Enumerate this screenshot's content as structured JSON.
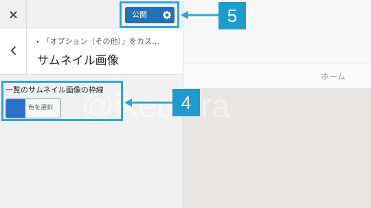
{
  "topbar": {
    "close_icon": "close-icon",
    "publish_label": "公開",
    "publish_icon": "gear-icon"
  },
  "section": {
    "back_icon": "chevron-left-icon",
    "breadcrumb_prefix": "▸",
    "breadcrumb": "「オプション（その他）」をカス…",
    "title": "サムネイル画像"
  },
  "control": {
    "label": "一覧のサムネイル画像の枠線",
    "color_value": "#2c70c9",
    "button_label": "色を選択"
  },
  "preview": {
    "nav_home": "ホーム"
  },
  "annotations": {
    "callout_5": "5",
    "callout_4": "4",
    "accent": "#2ea6d6"
  },
  "watermark": "@ikedaira"
}
